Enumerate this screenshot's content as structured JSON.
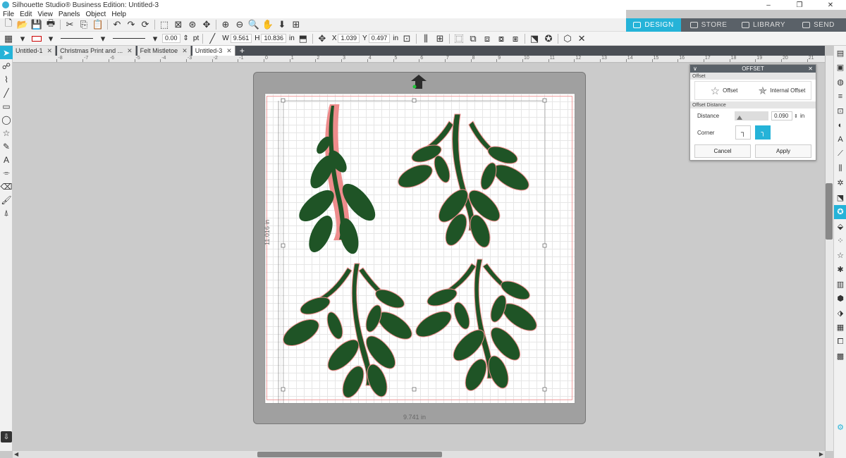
{
  "window": {
    "title": "Silhouette Studio® Business Edition: Untitled-3",
    "minimize": "–",
    "maximize": "❐",
    "close": "✕"
  },
  "menu": [
    "File",
    "Edit",
    "View",
    "Panels",
    "Object",
    "Help"
  ],
  "nav_tabs": [
    {
      "label": "DESIGN",
      "active": true
    },
    {
      "label": "STORE",
      "active": false
    },
    {
      "label": "LIBRARY",
      "active": false
    },
    {
      "label": "SEND",
      "active": false
    }
  ],
  "props": {
    "line_weight": "0.00",
    "line_unit": "pt",
    "w_label": "W",
    "width": "9.561",
    "h_label": "H",
    "height": "10.836",
    "size_unit": "in",
    "x_label": "X",
    "x": "1.039",
    "y_label": "Y",
    "y": "0.497",
    "pos_unit": "in"
  },
  "doc_tabs": [
    {
      "label": "Untitled-1",
      "active": false
    },
    {
      "label": "Christmas Print and ...",
      "active": false
    },
    {
      "label": "Felt Mistletoe",
      "active": false
    },
    {
      "label": "Untitled-3",
      "active": true
    }
  ],
  "ruler_labels": [
    "-8",
    "-7",
    "-6",
    "-5",
    "-4",
    "-3",
    "-2",
    "-1",
    "0",
    "1",
    "2",
    "3",
    "4",
    "5",
    "6",
    "7",
    "8",
    "9",
    "10",
    "11",
    "12",
    "13",
    "14",
    "15",
    "16",
    "17",
    "18",
    "19",
    "20",
    "21"
  ],
  "dimensions": {
    "width_label": "9.741 in",
    "height_label": "11.016 in"
  },
  "offset_panel": {
    "title": "OFFSET",
    "section_offset": "Offset",
    "opt_offset": "Offset",
    "opt_internal": "Internal Offset",
    "section_distance": "Offset Distance",
    "distance_label": "Distance",
    "distance_value": "0.090",
    "distance_unit": "in",
    "corner_label": "Corner",
    "cancel": "Cancel",
    "apply": "Apply"
  },
  "colors": {
    "accent": "#25b3d8",
    "leaf": "#1f5426",
    "cut_line": "#e88080",
    "nav_bg": "#5a6168"
  }
}
